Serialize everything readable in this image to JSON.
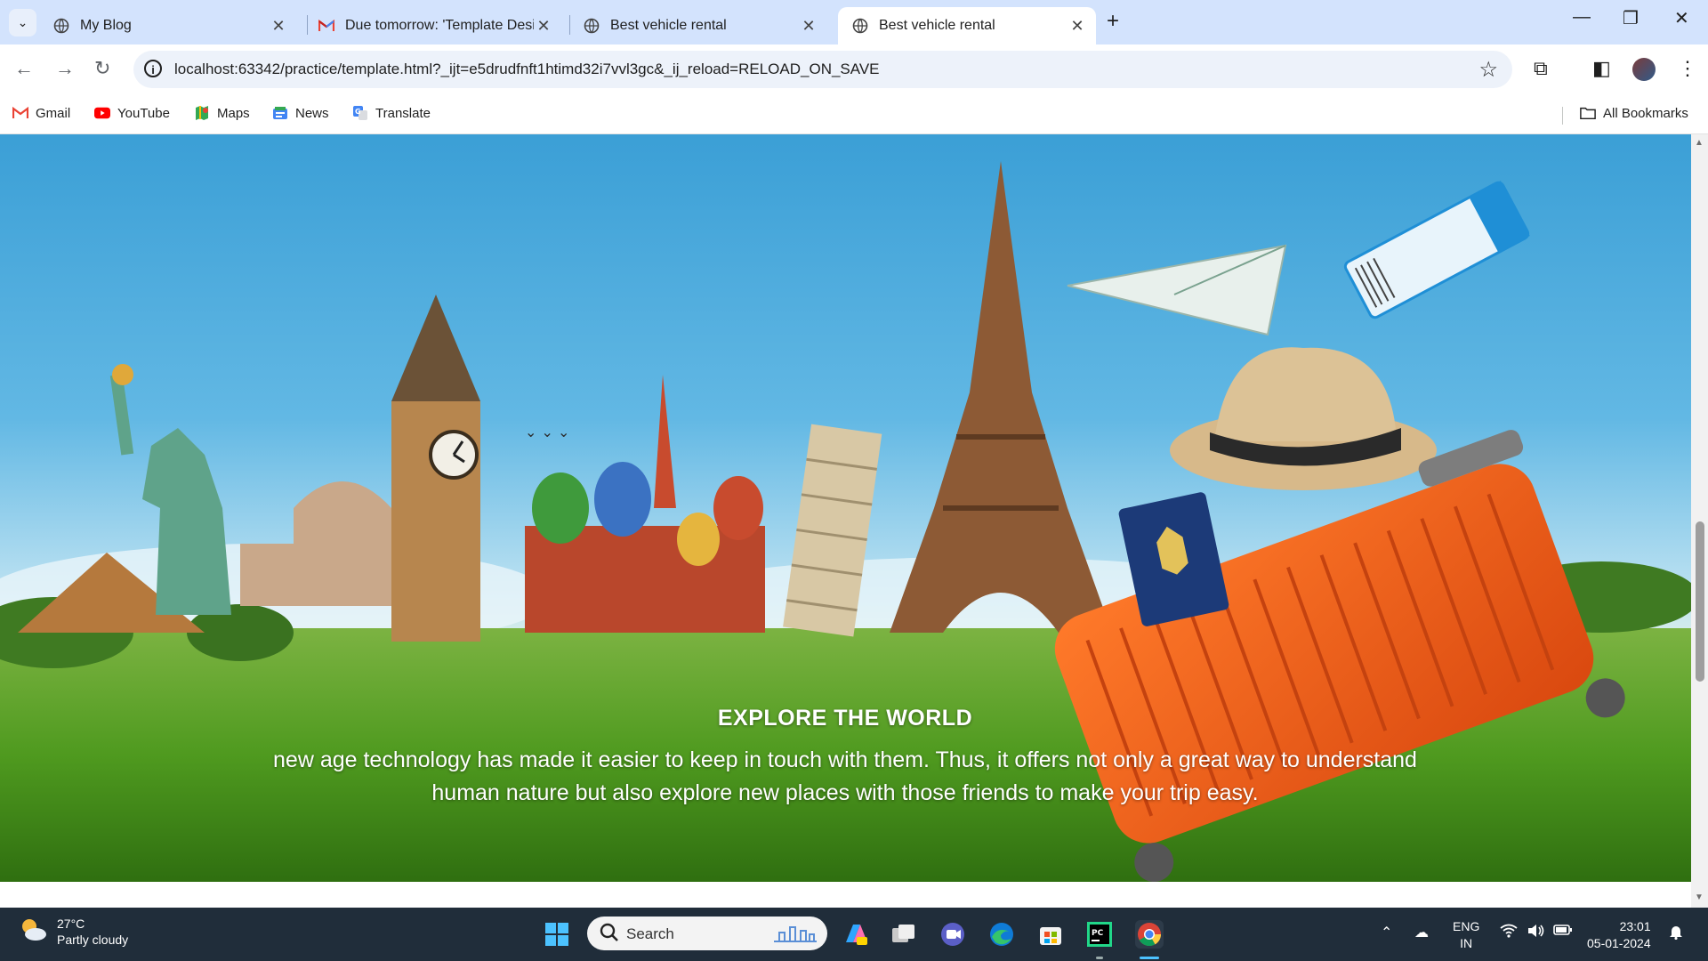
{
  "browser": {
    "tabs": [
      {
        "title": "My Blog",
        "icon": "globe-icon"
      },
      {
        "title": "Due tomorrow: 'Template Desig",
        "icon": "gmail-icon"
      },
      {
        "title": "Best vehicle rental",
        "icon": "globe-icon"
      },
      {
        "title": "Best vehicle rental",
        "icon": "globe-icon",
        "active": true
      }
    ],
    "url": "localhost:63342/practice/template.html?_ijt=e5drudfnft1htimd32i7vvl3gc&_ij_reload=RELOAD_ON_SAVE",
    "bookmarks": [
      {
        "label": "Gmail",
        "icon": "gmail-icon"
      },
      {
        "label": "YouTube",
        "icon": "youtube-icon"
      },
      {
        "label": "Maps",
        "icon": "maps-icon"
      },
      {
        "label": "News",
        "icon": "news-icon"
      },
      {
        "label": "Translate",
        "icon": "translate-icon"
      }
    ],
    "all_bookmarks": "All Bookmarks"
  },
  "hero": {
    "title": "EXPLORE THE WORLD",
    "body": "new age technology has made it easier to keep in touch with them. Thus, it offers not only a great way to understand human nature but also explore new places with those friends to make your trip easy."
  },
  "taskbar": {
    "weather_temp": "27°C",
    "weather_desc": "Partly cloudy",
    "search_label": "Search",
    "lang_line1": "ENG",
    "lang_line2": "IN",
    "time": "23:01",
    "date": "05-01-2024"
  },
  "colors": {
    "tabstrip": "#d3e3fd",
    "omnibox": "#edf2fa",
    "taskbar": "#202d3a",
    "suitcase": "#f0601a",
    "grass": "#4f9a1f",
    "sky": "#3b9fd6"
  }
}
